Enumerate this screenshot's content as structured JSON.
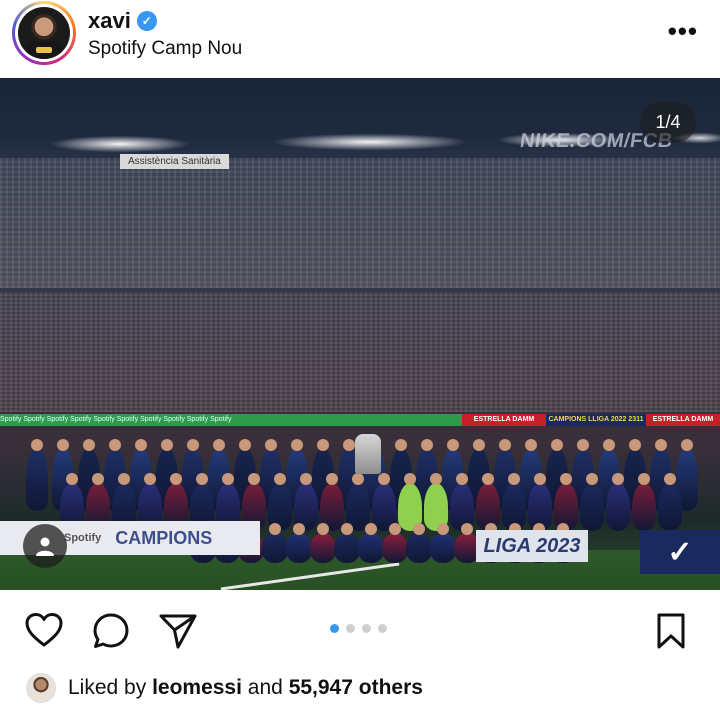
{
  "post": {
    "username": "xavi",
    "verified": true,
    "location": "Spotify Camp Nou",
    "more_label": "•••"
  },
  "media": {
    "counter": "1/4",
    "current_index": 1,
    "total": 4,
    "signage": {
      "upper_sign": "Assistència Sanitària",
      "nike_banner": "NIKE.COM/FCB",
      "ad_green": "Spotify   Spotify   Spotify   Spotify   Spotify   Spotify   Spotify   Spotify   Spotify   Spotify",
      "ad_estrella": "ESTRELLA DAMM",
      "ad_campions": "CAMPIONS LLIGA 2022 2311",
      "ad_estrella_2": "ESTRELLA DAMM",
      "front_spotify": "Spotify",
      "front_campions": "CAMPIONS",
      "front_liga": "LIGA 2023",
      "front_nike": "✓"
    }
  },
  "actions": {
    "like_icon": "heart-icon",
    "comment_icon": "comment-icon",
    "share_icon": "send-icon",
    "save_icon": "bookmark-icon"
  },
  "likes": {
    "prefix": "Liked by",
    "user": "leomessi",
    "middle": "and",
    "count": "55,947 others"
  },
  "colors": {
    "accent": "#3897f0",
    "text": "#111111",
    "dot_inactive": "#cfcfcf"
  }
}
